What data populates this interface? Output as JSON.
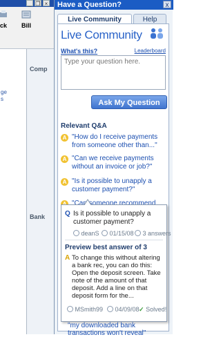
{
  "background_app": {
    "toolbar": [
      {
        "label": "ck",
        "icon": "printer-icon"
      },
      {
        "label": "Bill",
        "icon": "bill-icon"
      }
    ],
    "side_links": [
      "ge",
      "s"
    ],
    "section_labels": [
      "Comp",
      "Bank"
    ]
  },
  "panel": {
    "title": "Have a Question?",
    "close_label": "x",
    "tabs": [
      {
        "label": "Live Community",
        "active": true
      },
      {
        "label": "Help",
        "active": false
      }
    ],
    "brand_title": "Live Community",
    "whats_this": "What's this?",
    "leaderboard": "Leaderboard",
    "question_placeholder": "Type your question here.",
    "ask_button": "Ask My Question",
    "related_header": "Relevant Q&A",
    "related": [
      "\"How do I receive payments from someone other than...\"",
      "\"Can we receive payments without an invoice or job?\"",
      "\"Is it possible to unapply a customer payment?\"",
      "\"Can someone recommend"
    ],
    "last_item": "\"my downloaded bank transactions won't reveal\""
  },
  "popup": {
    "question": "Is it possible to unapply a customer payment?",
    "author": "deanS",
    "date": "01/15/08",
    "answers": "3 answers",
    "preview_header": "Preview best answer of 3",
    "answer": "To change this without altering a bank rec, you can do this: Open the deposit screen. Take note of the amount of that deposit. Add a line on that deposit form for the...",
    "answer_author": "MSmith99",
    "answer_date": "04/09/08",
    "solved": "Solved!"
  },
  "colors": {
    "title_bar": "#1b5cc4",
    "link": "#1c4fb0",
    "ask_button": "#3f74cf",
    "answer_badge": "#f1c232"
  }
}
